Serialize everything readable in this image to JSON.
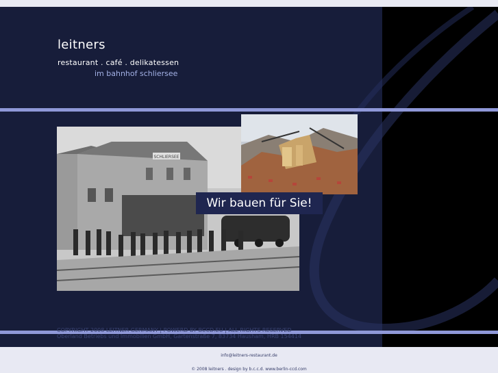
{
  "brand": {
    "name": "leitners",
    "tagline": "restaurant . café . delikatessen",
    "location": "im bahnhof schliersee"
  },
  "banner": {
    "slogan": "Wir bauen für Sie!",
    "station_sign": "SCHLIERSEE"
  },
  "footer": {
    "copyright": "COPYRIGHT 2008 LEITNER GERMANY | POWERD BY BCCD.EU | ALL RIGHTS RESERVED",
    "company": "Oberland Betriebs und Immobilien GmbH, Gartenstraße 7, 83734 Hausham, HRB 154414",
    "email": "info@leitners-restaurant.de",
    "credits": "© 2008 leitners . design by b.c.c.d. www.berlin-ccd.com"
  },
  "colors": {
    "panel": "#171d3a",
    "band": "#8f98d8",
    "accent_text": "#a3b1e6"
  }
}
